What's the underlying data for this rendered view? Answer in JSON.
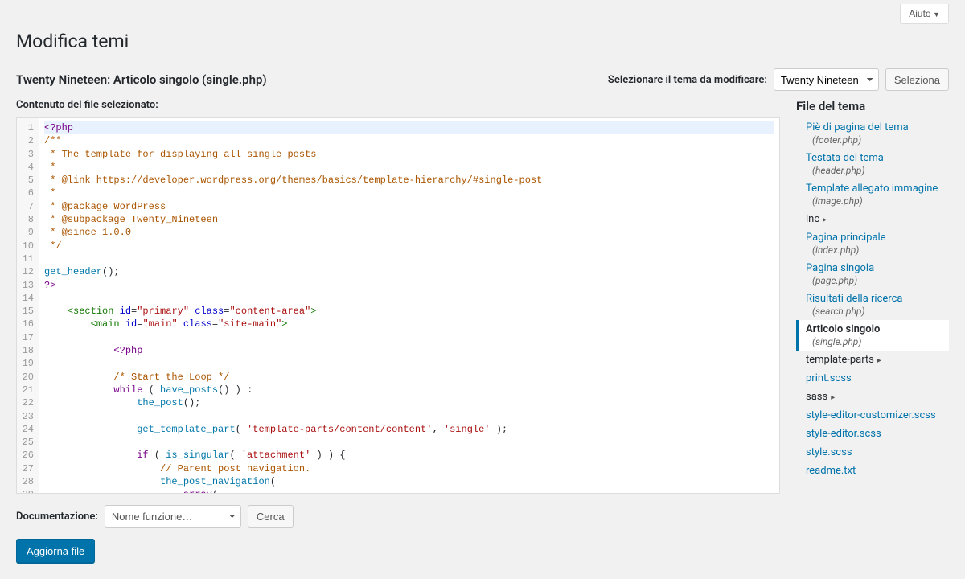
{
  "top": {
    "help": "Aiuto"
  },
  "page_title": "Modifica temi",
  "current_file_heading": "Twenty Nineteen: Articolo singolo (single.php)",
  "theme_selector": {
    "label": "Selezionare il tema da modificare:",
    "selected": "Twenty Nineteen",
    "button": "Seleziona"
  },
  "editor_label": "Contenuto del file selezionato:",
  "code_lines": [
    "<?php",
    "/**",
    " * The template for displaying all single posts",
    " *",
    " * @link https://developer.wordpress.org/themes/basics/template-hierarchy/#single-post",
    " *",
    " * @package WordPress",
    " * @subpackage Twenty_Nineteen",
    " * @since 1.0.0",
    " */",
    "",
    "get_header();",
    "?>",
    "",
    "    <section id=\"primary\" class=\"content-area\">",
    "        <main id=\"main\" class=\"site-main\">",
    "",
    "            <?php",
    "",
    "            /* Start the Loop */",
    "            while ( have_posts() ) :",
    "                the_post();",
    "",
    "                get_template_part( 'template-parts/content/content', 'single' );",
    "",
    "                if ( is_singular( 'attachment' ) ) {",
    "                    // Parent post navigation.",
    "                    the_post_navigation(",
    "                        array("
  ],
  "files_title": "File del tema",
  "files": [
    {
      "label": "Piè di pagina del tema",
      "sub": "(footer.php)",
      "type": "link"
    },
    {
      "label": "Testata del tema",
      "sub": "(header.php)",
      "type": "link"
    },
    {
      "label": "Template allegato immagine",
      "sub": "(image.php)",
      "type": "link"
    },
    {
      "label": "inc",
      "type": "folder"
    },
    {
      "label": "Pagina principale",
      "sub": "(index.php)",
      "type": "link"
    },
    {
      "label": "Pagina singola",
      "sub": "(page.php)",
      "type": "link"
    },
    {
      "label": "Risultati della ricerca",
      "sub": "(search.php)",
      "type": "link"
    },
    {
      "label": "Articolo singolo",
      "sub": "(single.php)",
      "type": "current"
    },
    {
      "label": "template-parts",
      "type": "folder"
    },
    {
      "label": "print.scss",
      "type": "plain"
    },
    {
      "label": "sass",
      "type": "folder"
    },
    {
      "label": "style-editor-customizer.scss",
      "type": "plain"
    },
    {
      "label": "style-editor.scss",
      "type": "plain"
    },
    {
      "label": "style.scss",
      "type": "plain"
    },
    {
      "label": "readme.txt",
      "type": "plain"
    }
  ],
  "documentation": {
    "label": "Documentazione:",
    "placeholder": "Nome funzione…",
    "search": "Cerca"
  },
  "update_button": "Aggiorna file"
}
